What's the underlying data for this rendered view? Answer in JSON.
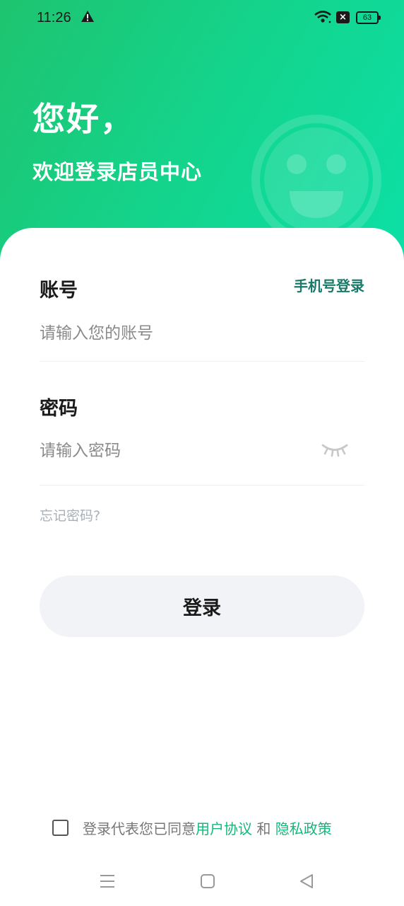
{
  "status_bar": {
    "time": "11:26",
    "warning_icon": "warning-icon",
    "wifi_icon": "wifi-icon",
    "x_badge": "×",
    "battery": "63"
  },
  "hero": {
    "greeting": "您好，",
    "subtitle": "欢迎登录店员中心",
    "decoration_icon": "smiley-face-icon",
    "gradient": [
      "#1ec46f",
      "#0ce0a8"
    ]
  },
  "form": {
    "account_label": "账号",
    "phone_login": "手机号登录",
    "account_placeholder": "请输入您的账号",
    "account_value": "",
    "password_label": "密码",
    "password_placeholder": "请输入密码",
    "password_value": "",
    "password_visibility_icon": "eye-closed-icon",
    "forgot_password": "忘记密码?",
    "login_button": "登录"
  },
  "agreement": {
    "checked": false,
    "prefix": "登录代表您已同意",
    "user_agreement": "用户协议",
    "conjunction": " 和 ",
    "privacy_policy": "隐私政策"
  },
  "nav_bar": {
    "menu_icon": "menu-icon",
    "home_icon": "home-square-icon",
    "back_icon": "back-triangle-icon"
  },
  "colors": {
    "accent": "#14b87a",
    "phone_login": "#1a7a6a",
    "button_bg": "#f2f3f6"
  }
}
